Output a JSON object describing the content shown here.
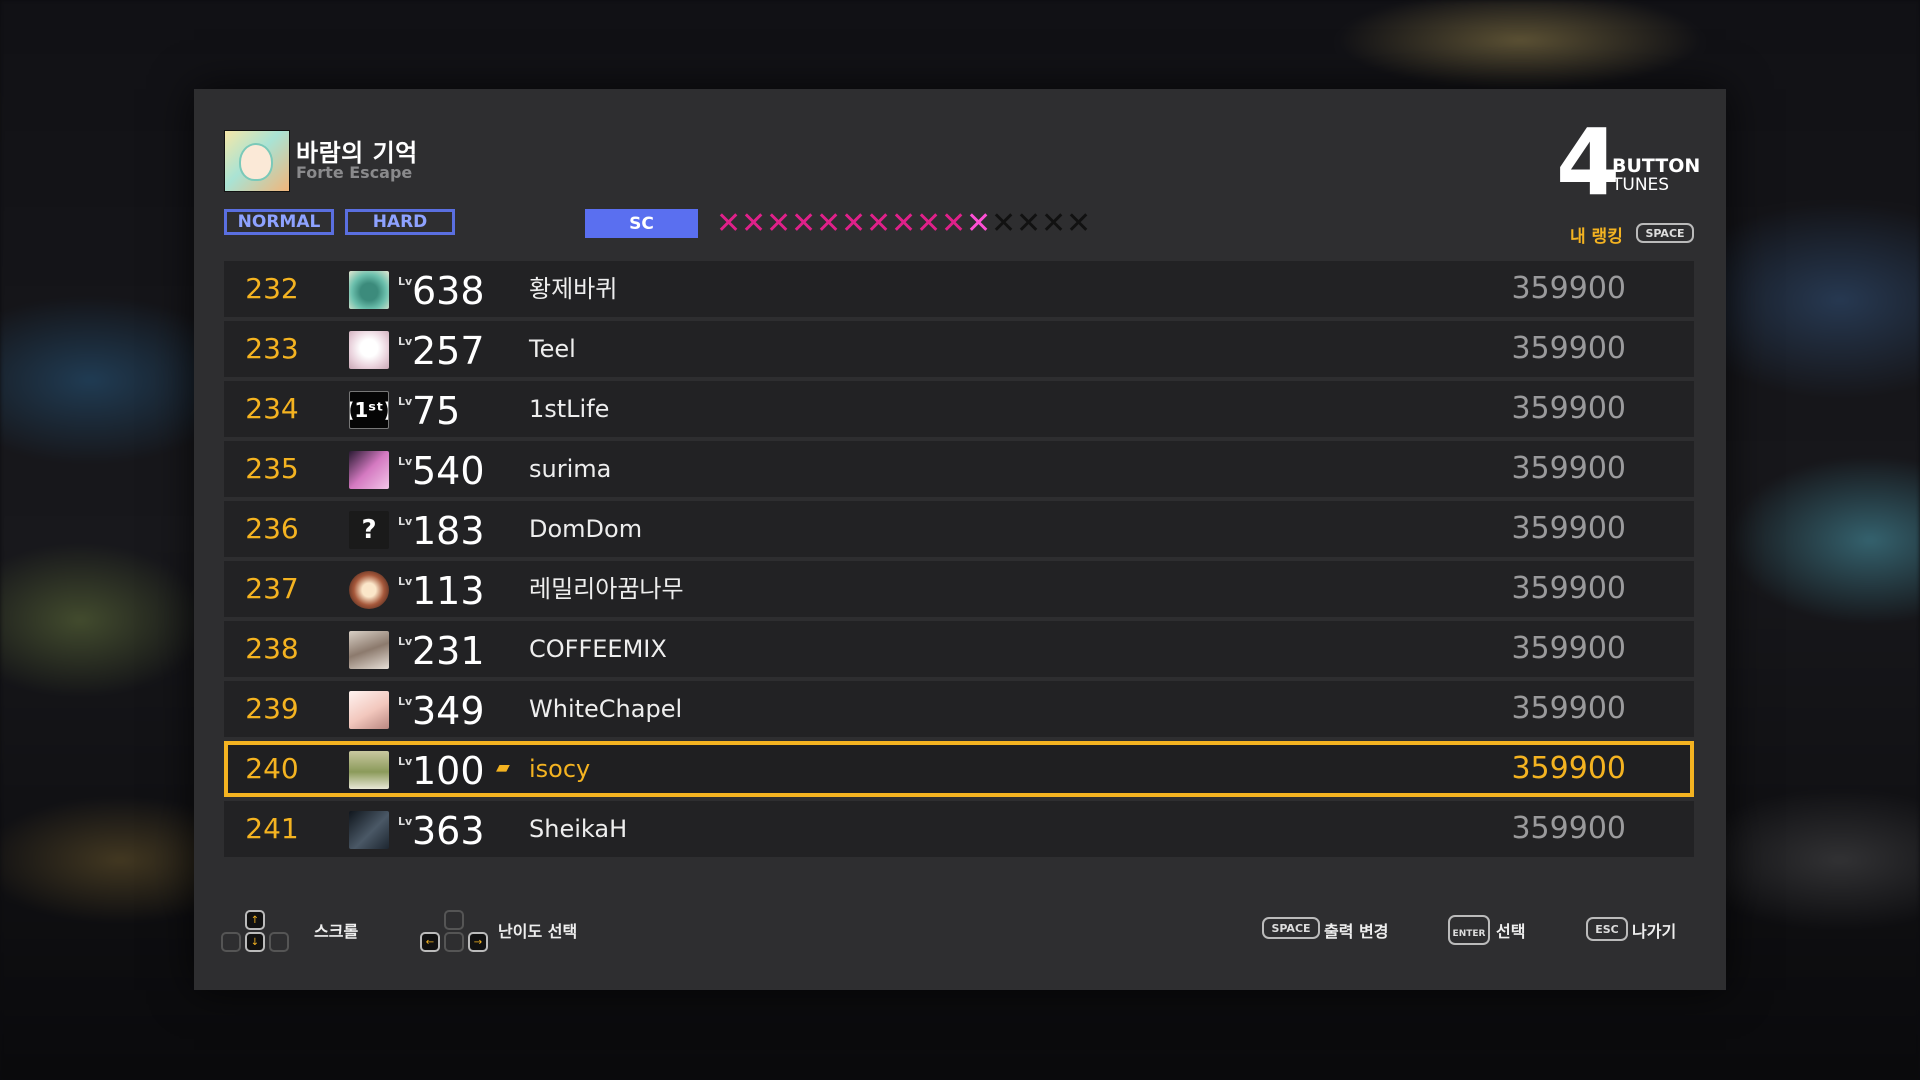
{
  "song": {
    "title": "바람의 기억",
    "artist": "Forte Escape"
  },
  "mode": {
    "number": "4",
    "line1": "BUTTON",
    "line2": "TUNES"
  },
  "difficulties": {
    "normal": "NORMAL",
    "hard": "HARD",
    "sc": "SC",
    "selected": "SC",
    "level": 11,
    "max_level": 15
  },
  "star_glyph": "✕",
  "my_ranking": {
    "label": "내 랭킹",
    "key": "SPACE"
  },
  "lv_tag": "Lv",
  "rankings": [
    {
      "rank": "232",
      "level": "638",
      "name": "황제바퀴",
      "score": "359900",
      "mine": false
    },
    {
      "rank": "233",
      "level": "257",
      "name": "Teel",
      "score": "359900",
      "mine": false
    },
    {
      "rank": "234",
      "level": "75",
      "name": "1stLife",
      "score": "359900",
      "mine": false,
      "avatar_text": "(1ˢᵗ)"
    },
    {
      "rank": "235",
      "level": "540",
      "name": "surima",
      "score": "359900",
      "mine": false
    },
    {
      "rank": "236",
      "level": "183",
      "name": "DomDom",
      "score": "359900",
      "mine": false,
      "avatar_text": "?"
    },
    {
      "rank": "237",
      "level": "113",
      "name": "레밀리아꿈나무",
      "score": "359900",
      "mine": false
    },
    {
      "rank": "238",
      "level": "231",
      "name": "COFFEEMIX",
      "score": "359900",
      "mine": false
    },
    {
      "rank": "239",
      "level": "349",
      "name": "WhiteChapel",
      "score": "359900",
      "mine": false
    },
    {
      "rank": "240",
      "level": "100",
      "name": "isocy",
      "score": "359900",
      "mine": true,
      "crown": "▰"
    },
    {
      "rank": "241",
      "level": "363",
      "name": "SheikaH",
      "score": "359900",
      "mine": false
    }
  ],
  "footer": {
    "scroll": "스크롤",
    "difficulty_select": "난이도 선택",
    "output_change_key": "SPACE",
    "output_change": "출력 변경",
    "select_key": "ENTER",
    "select": "선택",
    "exit_key": "ESC",
    "exit": "나가기"
  },
  "colors": {
    "accent": "#f4b321",
    "difficulty": "#5a6ff0",
    "star_on": "#e0208a",
    "star_off": "#111111"
  }
}
